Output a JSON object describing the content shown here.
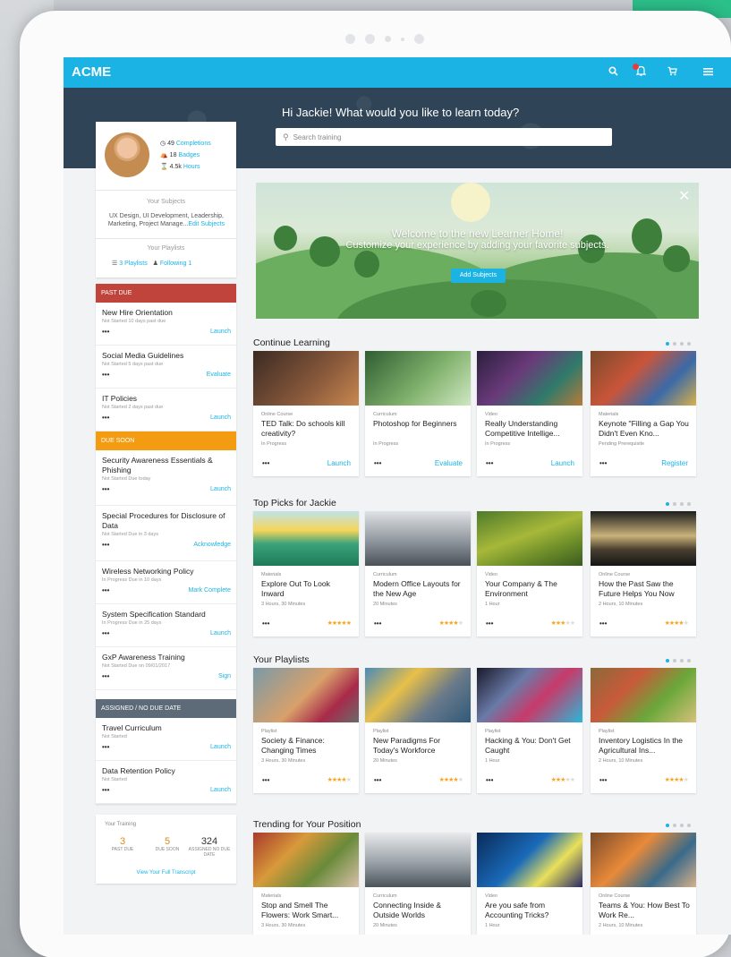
{
  "app": {
    "logo": "ACME"
  },
  "topbar": {
    "icons": [
      "search-icon",
      "bell-icon",
      "cart-icon",
      "menu-icon"
    ],
    "accent": "#1ab3e4"
  },
  "hero": {
    "greeting": "Hi Jackie! What would you like to learn today?",
    "search_placeholder": "Search training"
  },
  "profile": {
    "completions_count": "49",
    "completions_label": "Completions",
    "badges_count": "18",
    "badges_label": "Badges",
    "hours_count": "4.5k",
    "hours_label": "Hours",
    "subjects_title": "Your Subjects",
    "subjects_text": "UX Design, UI Development, Leadership, Marketing, Project Manage...",
    "edit_subjects": "Edit Subjects",
    "playlists_title": "Your Playlists",
    "playlists_link": "3 Playlists",
    "following_link": "Following 1"
  },
  "past_due": {
    "header": "PAST DUE",
    "color": "#c0443c",
    "items": [
      {
        "title": "New Hire Orientation",
        "status": "Not Started",
        "due": "10 days past due",
        "action": "Launch"
      },
      {
        "title": "Social Media Guidelines",
        "status": "Not Started",
        "due": "5 days past due",
        "action": "Evaluate"
      },
      {
        "title": "IT Policies",
        "status": "Not Started",
        "due": "2 days past due",
        "action": "Launch"
      }
    ]
  },
  "due_soon": {
    "header": "DUE SOON",
    "color": "#f39c12",
    "items": [
      {
        "title": "Security Awareness Essentials & Phishing",
        "status": "Not Started",
        "due": "Due today",
        "action": "Launch"
      },
      {
        "title": "Special Procedures for Disclosure of Data",
        "status": "Not Started",
        "due": "Due in 3 days",
        "action": "Acknowledge"
      },
      {
        "title": "Wireless Networking Policy",
        "status": "In Progress",
        "due": "Due in 10 days",
        "action": "Mark Complete"
      },
      {
        "title": "System Specification Standard",
        "status": "In Progress",
        "due": "Due in 25 days",
        "action": "Launch"
      },
      {
        "title": "GxP Awareness Training",
        "status": "Not Started",
        "due": "Due on 09/01/2017",
        "action": "Sign"
      }
    ]
  },
  "assigned": {
    "header": "ASSIGNED / NO DUE DATE",
    "color": "#5d6b78",
    "items": [
      {
        "title": "Travel Curriculum",
        "status": "Not Started",
        "due": "",
        "action": "Launch"
      },
      {
        "title": "Data Retention Policy",
        "status": "Not Started",
        "due": "",
        "action": "Launch"
      }
    ]
  },
  "training_summary": {
    "title": "Your Training",
    "past_due_count": "3",
    "past_due_label": "PAST DUE",
    "due_soon_count": "5",
    "due_soon_label": "DUE SOON",
    "assigned_count": "324",
    "assigned_label": "ASSIGNED NO DUE DATE",
    "transcript_link": "View Your Full Transcript"
  },
  "banner": {
    "title": "Welcome to the new Learner Home!",
    "subtitle": "Customize your experience by adding your favorite subjects.",
    "button": "Add Subjects",
    "close_icon": "close-icon"
  },
  "rows": [
    {
      "title": "Continue Learning",
      "tiles": [
        {
          "kind": "Online Course",
          "title": "TED Talk: Do schools kill creativity?",
          "meta": "In Progress",
          "action": "Launch",
          "rating": null
        },
        {
          "kind": "Curriculum",
          "title": "Photoshop for Beginners",
          "meta": "In Progress",
          "action": "Evaluate",
          "rating": null
        },
        {
          "kind": "Video",
          "title": "Really Understanding Competitive Intellige...",
          "meta": "In Progress",
          "action": "Launch",
          "rating": null
        },
        {
          "kind": "Materials",
          "title": "Keynote \"Filling a Gap You Didn't Even Kno...",
          "meta": "Pending Prerequisite",
          "action": "Register",
          "rating": null
        }
      ]
    },
    {
      "title": "Top Picks for Jackie",
      "tiles": [
        {
          "kind": "Materials",
          "title": "Explore Out To Look Inward",
          "meta": "3 Hours, 30 Minutes",
          "action": "",
          "rating": 5
        },
        {
          "kind": "Curriculum",
          "title": "Modern Office Layouts for the New Age",
          "meta": "20 Minutes",
          "action": "",
          "rating": 3.5
        },
        {
          "kind": "Video",
          "title": "Your Company & The Environment",
          "meta": "1 Hour",
          "action": "",
          "rating": 2.5
        },
        {
          "kind": "Online Course",
          "title": "How the Past Saw the Future Helps You Now",
          "meta": "2 Hours, 10 Minutes",
          "action": "",
          "rating": 3.5
        }
      ]
    },
    {
      "title": "Your Playlists",
      "tiles": [
        {
          "kind": "Playlist",
          "title": "Society & Finance: Changing Times",
          "meta": "3 Hours, 30 Minutes",
          "action": "",
          "rating": 4
        },
        {
          "kind": "Playlist",
          "title": "New Paradigms For Today's Workforce",
          "meta": "20 Minutes",
          "action": "",
          "rating": 3.5
        },
        {
          "kind": "Playlist",
          "title": "Hacking & You: Don't Get Caught",
          "meta": "1 Hour",
          "action": "",
          "rating": 2.5
        },
        {
          "kind": "Playlist",
          "title": "Inventory Logistics In the Agricultural Ins...",
          "meta": "2 Hours, 10 Minutes",
          "action": "",
          "rating": 3.5
        }
      ]
    },
    {
      "title": "Trending for Your Position",
      "tiles": [
        {
          "kind": "Materials",
          "title": "Stop and Smell The Flowers: Work Smart...",
          "meta": "3 Hours, 30 Minutes",
          "action": "",
          "rating": null
        },
        {
          "kind": "Curriculum",
          "title": "Connecting Inside & Outside Worlds",
          "meta": "20 Minutes",
          "action": "",
          "rating": null
        },
        {
          "kind": "Video",
          "title": "Are you safe from Accounting Tricks?",
          "meta": "1 Hour",
          "action": "",
          "rating": null
        },
        {
          "kind": "Online Course",
          "title": "Teams & You: How Best To Work Re...",
          "meta": "2 Hours, 10 Minutes",
          "action": "",
          "rating": null
        }
      ]
    }
  ]
}
